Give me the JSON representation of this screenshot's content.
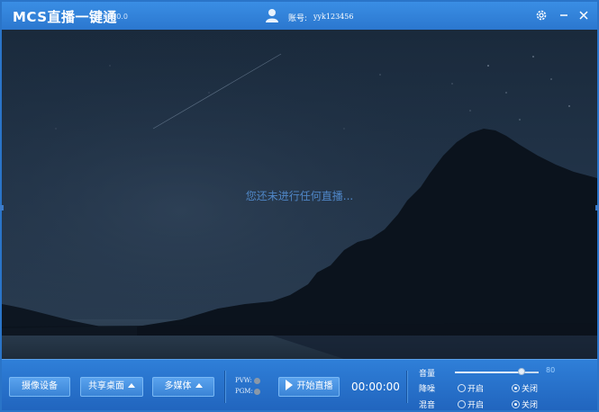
{
  "title_bar": {
    "app_name": "MCS直播一键通",
    "version": "2.0.0.0",
    "account_label": "账号:",
    "account_value": "yyk123456",
    "icons": [
      "user-icon",
      "gear-icon",
      "minimize-icon",
      "close-icon"
    ]
  },
  "preview": {
    "status_text": "您还未进行任何直播..."
  },
  "controls": {
    "camera_button": "摄像设备",
    "share_desktop_button": "共享桌面",
    "multimedia_button": "多媒体",
    "pvw_label": "PVW:",
    "pgm_label": "PGM:",
    "start_live_button": "开始直播",
    "timer": "00:00:00"
  },
  "audio": {
    "volume_label": "音量",
    "volume_value": "80",
    "volume_level": 0.8,
    "noise_label": "降噪",
    "reverb_label": "混音",
    "on_label": "开启",
    "off_label": "关闭",
    "noise_selected": "关闭",
    "reverb_selected": "关闭"
  },
  "colors": {
    "title_bar": "#2b77cf",
    "control_bar": "#2165be",
    "status_text": "#4f86c6"
  }
}
